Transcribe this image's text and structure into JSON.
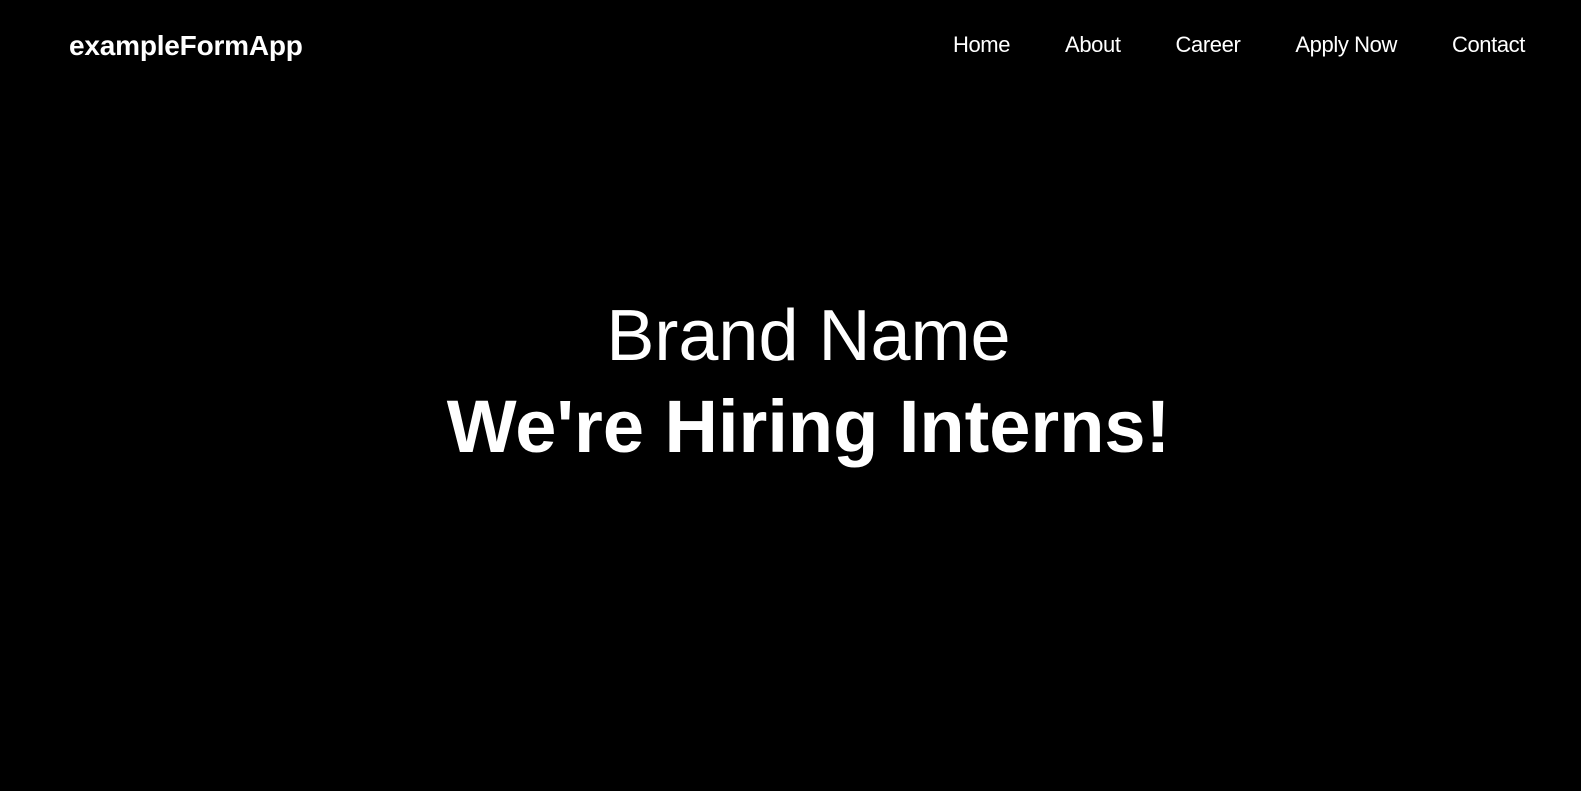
{
  "header": {
    "brand": "exampleFormApp",
    "nav_items": [
      {
        "label": "Home"
      },
      {
        "label": "About"
      },
      {
        "label": "Career"
      },
      {
        "label": "Apply Now"
      },
      {
        "label": "Contact"
      }
    ]
  },
  "hero": {
    "brand_name": "Brand Name",
    "headline": "We're Hiring Interns!"
  },
  "colors": {
    "background": "#000000",
    "text": "#ffffff"
  }
}
